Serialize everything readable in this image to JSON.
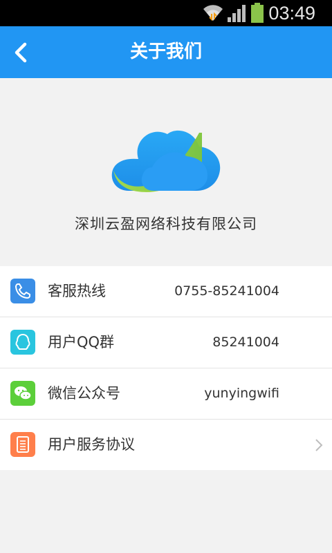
{
  "status_bar": {
    "time": "03:49"
  },
  "header": {
    "title": "关于我们"
  },
  "company": {
    "name": "深圳云盈网络科技有限公司"
  },
  "items": [
    {
      "label": "客服热线",
      "value": "0755-85241004",
      "icon": "phone-icon",
      "color": "#3a8ee6"
    },
    {
      "label": "用户QQ群",
      "value": "85241004",
      "icon": "qq-icon",
      "color": "#29c5df"
    },
    {
      "label": "微信公众号",
      "value": "yunyingwifi",
      "icon": "wechat-icon",
      "color": "#5ccf3a"
    },
    {
      "label": "用户服务协议",
      "value": "",
      "icon": "document-icon",
      "color": "#ff7f4b"
    }
  ],
  "colors": {
    "header": "#2196f3",
    "background": "#f2f2f2"
  }
}
